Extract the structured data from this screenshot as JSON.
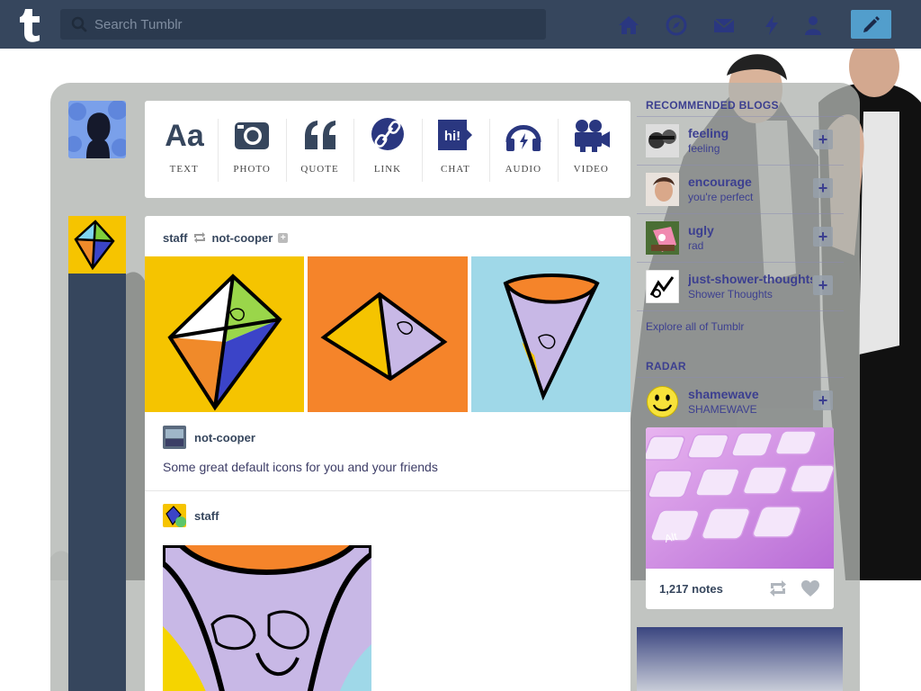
{
  "topbar": {
    "search_placeholder": "Search Tumblr",
    "nav_icons": [
      "home-icon",
      "explore-icon",
      "inbox-icon",
      "activity-icon",
      "account-icon"
    ],
    "compose_icon": "pencil-icon",
    "colors": {
      "bar": "#36465d",
      "compose": "#529ecc"
    }
  },
  "post_types": [
    {
      "label": "TEXT",
      "icon": "text-icon"
    },
    {
      "label": "PHOTO",
      "icon": "camera-icon"
    },
    {
      "label": "QUOTE",
      "icon": "quote-icon"
    },
    {
      "label": "LINK",
      "icon": "link-icon"
    },
    {
      "label": "CHAT",
      "icon": "chat-icon"
    },
    {
      "label": "AUDIO",
      "icon": "headphones-icon"
    },
    {
      "label": "VIDEO",
      "icon": "video-camera-icon"
    }
  ],
  "post": {
    "author": "staff",
    "reblogged_from": "not-cooper",
    "reblog_1": {
      "blog": "not-cooper",
      "caption": "Some great default icons for you and your friends"
    },
    "reblog_2": {
      "blog": "staff"
    }
  },
  "sidebar": {
    "recommended_title": "RECOMMENDED BLOGS",
    "blogs": [
      {
        "name": "feeling",
        "subtitle": "feeling"
      },
      {
        "name": "encourage",
        "subtitle": "you're perfect"
      },
      {
        "name": "ugly",
        "subtitle": "rad"
      },
      {
        "name": "just-shower-thoughts",
        "subtitle": "Shower Thoughts"
      }
    ],
    "follow_symbol": "+",
    "explore_link": "Explore all of Tumblr",
    "radar_title": "RADAR",
    "radar": {
      "blog": "shamewave",
      "subtitle": "SHAMEWAVE",
      "notes": "1,217 notes",
      "key_label": "Alt"
    }
  }
}
